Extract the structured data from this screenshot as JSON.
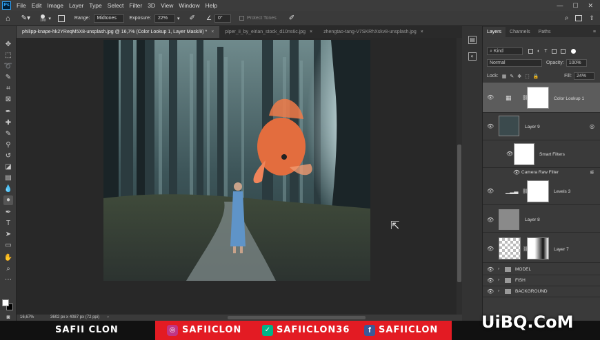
{
  "menubar": {
    "app_icon": "Ps",
    "items": [
      "File",
      "Edit",
      "Image",
      "Layer",
      "Type",
      "Select",
      "Filter",
      "3D",
      "View",
      "Window",
      "Help"
    ]
  },
  "options": {
    "brush_size": "100",
    "range_label": "Range:",
    "range_value": "Midtones",
    "exposure_label": "Exposure:",
    "exposure_value": "22%",
    "angle_value": "0°",
    "protect_tones": "Protect Tones"
  },
  "tabs": [
    {
      "label": "philipp-knape-hk2YReqM5X8-unsplash.jpg @ 16,7% (Color Lookup 1, Layer Mask/8) *",
      "active": true
    },
    {
      "label": "piper_ii_by_eirian_stock_d10ns6c.jpg",
      "active": false
    },
    {
      "label": "zhengtao-tang-V7SKRhXskv8-unsplash.jpg",
      "active": false
    }
  ],
  "status": {
    "zoom": "16,67%",
    "doc_info": "3602 px x 4087 px (72 ppi)"
  },
  "panel": {
    "tabs": [
      "Layers",
      "Channels",
      "Paths"
    ],
    "kind_label": "Kind",
    "blend_mode": "Normal",
    "opacity_label": "Opacity:",
    "opacity_value": "100%",
    "lock_label": "Lock:",
    "fill_label": "Fill:",
    "fill_value": "24%",
    "layers": [
      {
        "name": "Color Lookup 1"
      },
      {
        "name": "Layer 9"
      },
      {
        "name": "Smart Filters"
      },
      {
        "name": "Camera Raw Filter"
      },
      {
        "name": "Levels 3"
      },
      {
        "name": "Layer 8"
      },
      {
        "name": "Layer 7"
      },
      {
        "name": "MODEL"
      },
      {
        "name": "FISH"
      },
      {
        "name": "BACKGROUND"
      }
    ]
  },
  "bottom_bar": {
    "brand_name": "SAFII CLON",
    "instagram_handle": "SAFIICLON",
    "vine_handle": "SAFIICLON36",
    "facebook_handle": "SAFIICLON",
    "watermark": "UiBQ.CoM",
    "colors": {
      "red": "#e31b23",
      "dark": "#111111"
    }
  }
}
